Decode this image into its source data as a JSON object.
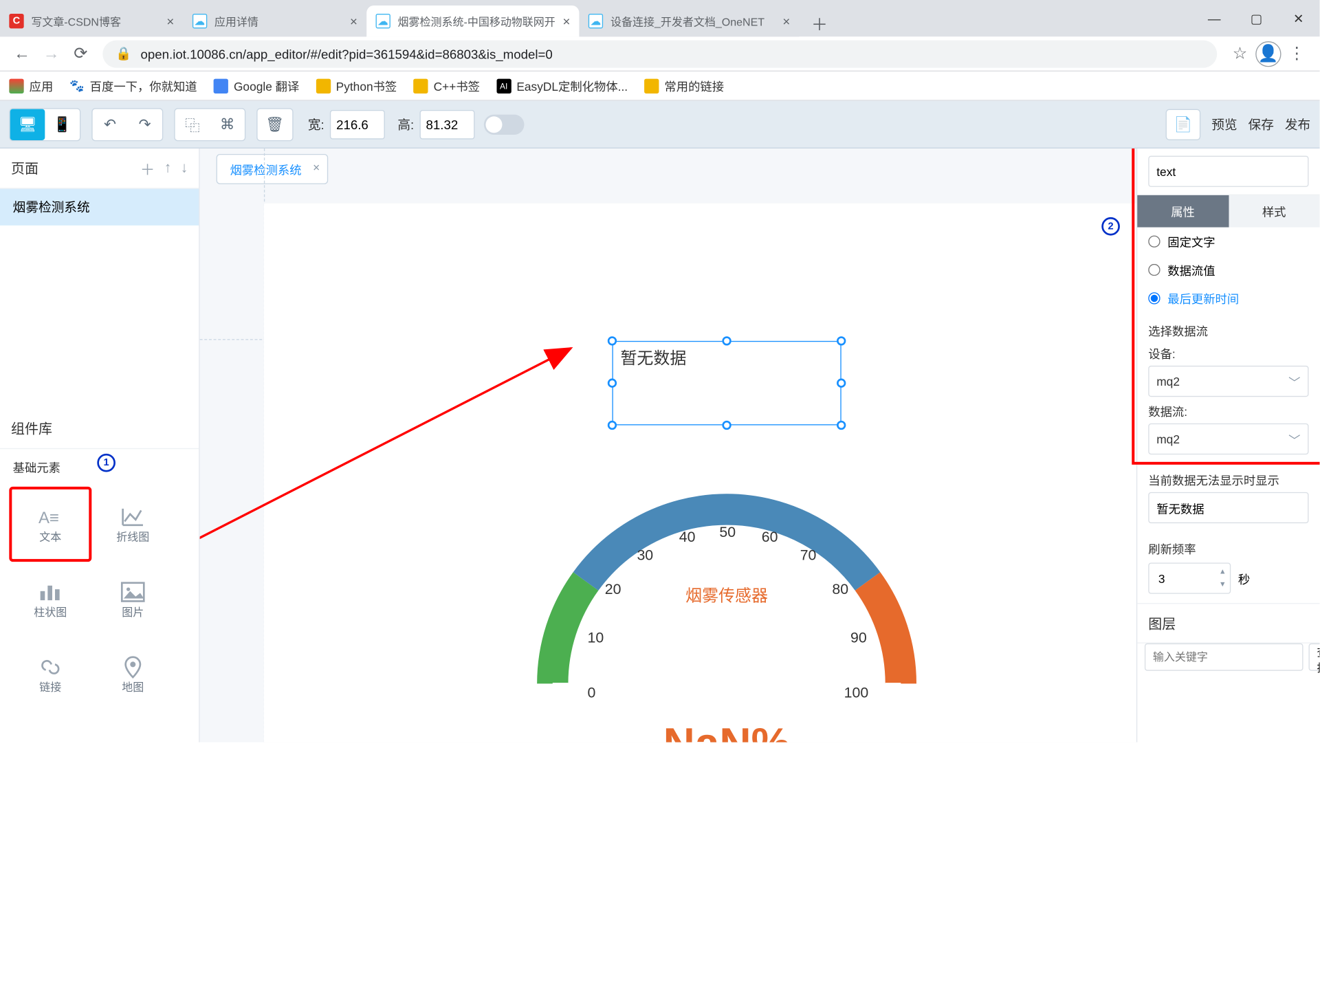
{
  "browser": {
    "tabs": [
      {
        "title": "写文章-CSDN博客",
        "icon_bg": "#e33029",
        "icon_txt": "C"
      },
      {
        "title": "应用详情",
        "icon_bg": "#3fb6f1",
        "icon_txt": "☁"
      },
      {
        "title": "烟雾检测系统-中国移动物联网开",
        "icon_bg": "#3fb6f1",
        "icon_txt": "☁",
        "active": true
      },
      {
        "title": "设备连接_开发者文档_OneNET",
        "icon_bg": "#3fb6f1",
        "icon_txt": "☁"
      }
    ],
    "url": "open.iot.10086.cn/app_editor/#/edit?pid=361594&id=86803&is_model=0"
  },
  "bookmarks": [
    {
      "label": "应用",
      "color": "#f2b600",
      "shape": "grid"
    },
    {
      "label": "百度一下，你就知道",
      "color": "#2a5fd4"
    },
    {
      "label": "Google 翻译",
      "color": "#4285f4"
    },
    {
      "label": "Python书签",
      "color": "#f2b600"
    },
    {
      "label": "C++书签",
      "color": "#f2b600"
    },
    {
      "label": "EasyDL定制化物体...",
      "color": "#000",
      "txt": "AI"
    },
    {
      "label": "常用的链接",
      "color": "#f2b600"
    }
  ],
  "toolbar": {
    "width_label": "宽:",
    "width_val": "216.6",
    "height_label": "高:",
    "height_val": "81.32",
    "preview": "预览",
    "save": "保存",
    "publish": "发布"
  },
  "sidebar": {
    "pages_title": "页面",
    "page_item": "烟雾检测系统",
    "lib_title": "组件库",
    "basic_label": "基础元素",
    "comps": [
      "文本",
      "折线图",
      "柱状图",
      "图片",
      "链接",
      "地图"
    ]
  },
  "canvas": {
    "tab": "烟雾检测系统",
    "sel_text": "暂无数据",
    "gauge": {
      "title": "烟雾传感器",
      "value": "NaN%",
      "ticks": [
        "0",
        "10",
        "20",
        "30",
        "40",
        "50",
        "60",
        "70",
        "80",
        "90",
        "100"
      ]
    }
  },
  "panel": {
    "name_val": "text",
    "tabs": {
      "attr": "属性",
      "style": "样式"
    },
    "radios": {
      "fixed": "固定文字",
      "flow": "数据流值",
      "last": "最后更新时间"
    },
    "stream_label": "选择数据流",
    "device_label": "设备:",
    "device_val": "mq2",
    "flow_label": "数据流:",
    "flow_val": "mq2",
    "nodata_label": "当前数据无法显示时显示",
    "nodata_val": "暂无数据",
    "refresh_label": "刷新频率",
    "refresh_val": "3",
    "refresh_unit": "秒",
    "layer_label": "图层",
    "search_ph": "输入关键字",
    "search_btn": "查找"
  },
  "chart_data": {
    "type": "gauge",
    "title": "烟雾传感器",
    "value": null,
    "display": "NaN%",
    "unit": "%",
    "range": [
      0,
      100
    ],
    "ticks": [
      0,
      10,
      20,
      30,
      40,
      50,
      60,
      70,
      80,
      90,
      100
    ],
    "color_bands": [
      {
        "from": 0,
        "to": 20,
        "color": "#4caf50"
      },
      {
        "from": 20,
        "to": 80,
        "color": "#4a89b8"
      },
      {
        "from": 80,
        "to": 100,
        "color": "#e66a2c"
      }
    ]
  }
}
